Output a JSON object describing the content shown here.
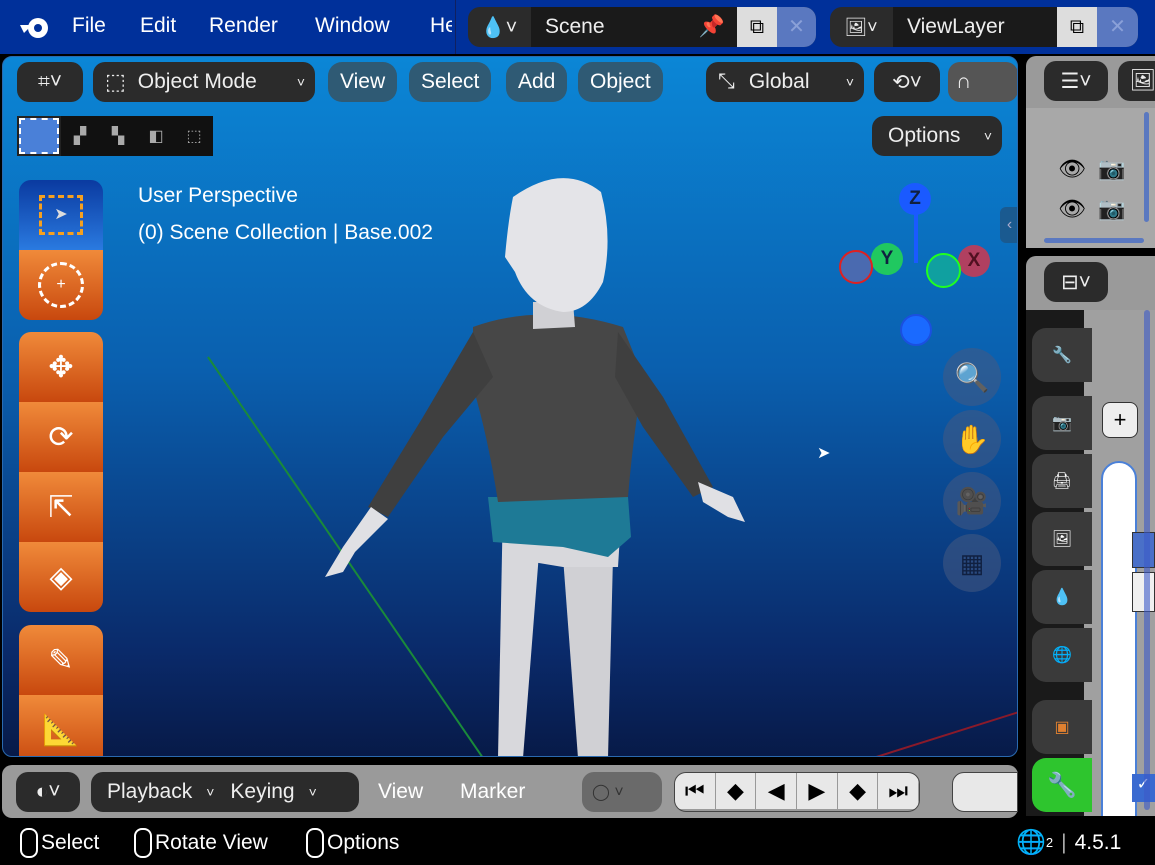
{
  "topbar": {
    "menu": [
      "File",
      "Edit",
      "Render",
      "Window",
      "He"
    ],
    "scene": "Scene",
    "view_layer": "ViewLayer"
  },
  "viewport": {
    "header": {
      "mode": "Object Mode",
      "menus": [
        "View",
        "Select",
        "Add",
        "Object"
      ],
      "orientation": "Global",
      "options": "Options"
    },
    "overlay": {
      "line1": "User Perspective",
      "line2": "(0) Scene Collection | Base.002"
    },
    "gizmo": {
      "x": "X",
      "y": "Y",
      "z": "Z"
    },
    "tools": [
      "select-box",
      "cursor",
      "move",
      "rotate",
      "scale",
      "transform",
      "annotate",
      "measure"
    ]
  },
  "timeline": {
    "menus": [
      "Playback",
      "Keying",
      "View",
      "Marker"
    ]
  },
  "status": {
    "items": [
      "Select",
      "Rotate View",
      "Options"
    ],
    "version": "4.5.1",
    "lang_sub": "2"
  },
  "colors": {
    "topbar": "#00309a",
    "tool_active": "#1a5fd0",
    "tool": "#e0601e",
    "wrench_tab": "#2ec52e"
  }
}
